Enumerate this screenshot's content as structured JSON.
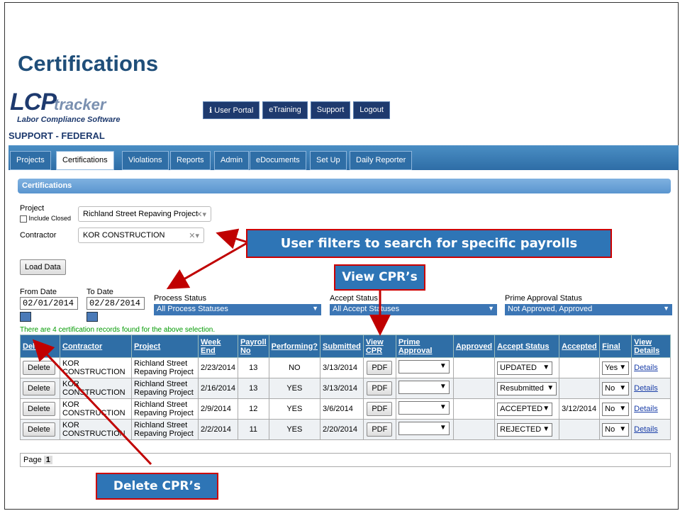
{
  "slide_title": "Certifications",
  "logo": {
    "main": "LCP",
    "tracker": "tracker",
    "sub": "Labor Compliance Software"
  },
  "top_nav": [
    "User Portal",
    "eTraining",
    "Support",
    "Logout"
  ],
  "client_name": "SUPPORT - FEDERAL",
  "tabs": [
    "Projects",
    "Certifications",
    "Violations",
    "Reports",
    "Admin",
    "eDocuments",
    "Set Up",
    "Daily Reporter"
  ],
  "section_title": "Certifications",
  "filters": {
    "project_label": "Project",
    "include_closed_label": "Include Closed",
    "project_value": "Richland Street Repaving Project",
    "contractor_label": "Contractor",
    "contractor_value": "KOR CONSTRUCTION",
    "load_button": "Load Data",
    "from_date_label": "From Date",
    "from_date": "02/01/2014",
    "to_date_label": "To Date",
    "to_date": "02/28/2014",
    "process_status_label": "Process Status",
    "process_status_value": "All Process Statuses",
    "accept_status_label": "Accept Status",
    "accept_status_value": "All Accept Statuses",
    "prime_approval_label": "Prime Approval Status",
    "prime_approval_value": "Not Approved, Approved"
  },
  "found_text": "There are 4 certification records found for the above selection.",
  "table": {
    "headers": [
      "Delete",
      "Contractor",
      "Project",
      "Week End",
      "Payroll No",
      "Performing?",
      "Submitted",
      "View CPR",
      "Prime Approval",
      "Approved",
      "Accept Status",
      "Accepted",
      "Final",
      "View Details"
    ],
    "rows": [
      {
        "delete": "Delete",
        "contractor": "KOR CONSTRUCTION",
        "project": "Richland Street Repaving Project",
        "week_end": "2/23/2014",
        "payroll": "13",
        "performing": "NO",
        "submitted": "3/13/2014",
        "cpr": "PDF",
        "prime": "",
        "approved": "",
        "accept": "UPDATED",
        "accepted": "",
        "final": "Yes",
        "details": "Details"
      },
      {
        "delete": "Delete",
        "contractor": "KOR CONSTRUCTION",
        "project": "Richland Street Repaving Project",
        "week_end": "2/16/2014",
        "payroll": "13",
        "performing": "YES",
        "submitted": "3/13/2014",
        "cpr": "PDF",
        "prime": "",
        "approved": "",
        "accept": "Resubmitted",
        "accepted": "",
        "final": "No",
        "details": "Details"
      },
      {
        "delete": "Delete",
        "contractor": "KOR CONSTRUCTION",
        "project": "Richland Street Repaving Project",
        "week_end": "2/9/2014",
        "payroll": "12",
        "performing": "YES",
        "submitted": "3/6/2014",
        "cpr": "PDF",
        "prime": "",
        "approved": "",
        "accept": "ACCEPTED",
        "accepted": "3/12/2014",
        "final": "No",
        "details": "Details"
      },
      {
        "delete": "Delete",
        "contractor": "KOR CONSTRUCTION",
        "project": "Richland Street Repaving Project",
        "week_end": "2/2/2014",
        "payroll": "11",
        "performing": "YES",
        "submitted": "2/20/2014",
        "cpr": "PDF",
        "prime": "",
        "approved": "",
        "accept": "REJECTED",
        "accepted": "",
        "final": "No",
        "details": "Details"
      }
    ]
  },
  "pager": {
    "label": "Page",
    "current": "1"
  },
  "callouts": {
    "filters": "User filters to search for specific payrolls",
    "view_cpr": "View CPR’s",
    "delete": "Delete CPR’s"
  },
  "colors": {
    "accent": "#2e75b6",
    "callout_border": "#cc0000",
    "arrow": "#c00000",
    "title": "#1f4e79"
  }
}
